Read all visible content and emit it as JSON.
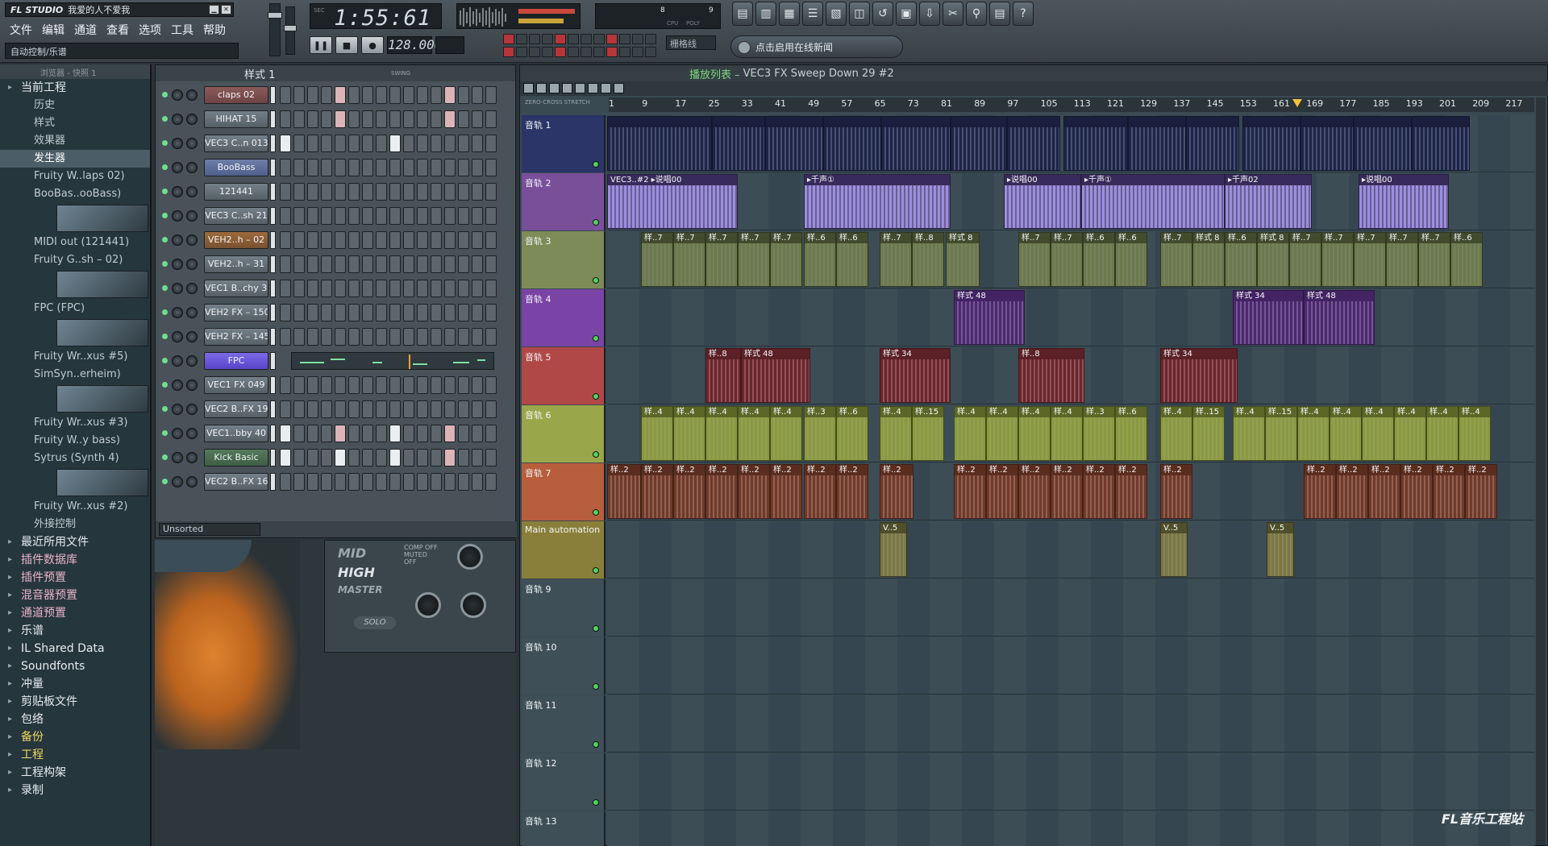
{
  "app": {
    "logo": "FL STUDIO",
    "song_title": "我爱的人不爱我",
    "win_min": "▁",
    "win_close": "✕",
    "hint": "自动控制/乐谱"
  },
  "menu": [
    "文件",
    "编辑",
    "通道",
    "查看",
    "选项",
    "工具",
    "帮助"
  ],
  "transport": {
    "time": "1:55:61",
    "time_units": "SEC",
    "tempo": "128.000",
    "tempo_label": "TEMPO",
    "pause": "❚❚",
    "stop": "■",
    "record": "●",
    "snap": "栅格线",
    "news": "点击启用在线新闻",
    "perf_left": "8",
    "perf_right": "9",
    "perf_cpu": "CPU",
    "perf_poly": "POLY"
  },
  "toolbar_icons": [
    "playlist-icon",
    "piano-roll-icon",
    "channel-rack-icon",
    "mixer-icon",
    "browser-icon",
    "plugin-icon",
    "undo-icon",
    "save-icon",
    "export-icon",
    "settings-icon",
    "search-icon",
    "clipboard-icon",
    "help-icon"
  ],
  "toolbar_glyphs": [
    "▤",
    "▥",
    "▦",
    "☰",
    "▧",
    "◫",
    "↺",
    "▣",
    "⇩",
    "✂",
    "⚲",
    "▤",
    "?"
  ],
  "browser": {
    "header": "浏览器 - 快照 1",
    "items": [
      {
        "label": "当前工程",
        "cls": "top"
      },
      {
        "label": "历史",
        "cls": "sub"
      },
      {
        "label": "样式",
        "cls": "sub"
      },
      {
        "label": "效果器",
        "cls": "sub"
      },
      {
        "label": "发生器",
        "cls": "sub sel"
      },
      {
        "label": "Fruity W..laps 02)",
        "cls": "sub"
      },
      {
        "label": "BooBas..ooBass)",
        "cls": "sub thumb"
      },
      {
        "label": "MIDI out (121441)",
        "cls": "sub"
      },
      {
        "label": "Fruity G..sh – 02)",
        "cls": "sub thumb"
      },
      {
        "label": "FPC (FPC)",
        "cls": "sub thumb"
      },
      {
        "label": "Fruity Wr..xus #5)",
        "cls": "sub"
      },
      {
        "label": "SimSyn..erheim)",
        "cls": "sub thumb"
      },
      {
        "label": "Fruity Wr..xus #3)",
        "cls": "sub"
      },
      {
        "label": "Fruity W..y bass)",
        "cls": "sub"
      },
      {
        "label": "Sytrus (Synth 4)",
        "cls": "sub thumb"
      },
      {
        "label": "Fruity Wr..xus #2)",
        "cls": "sub"
      },
      {
        "label": "外接控制",
        "cls": "sub"
      },
      {
        "label": "最近所用文件",
        "cls": "top"
      },
      {
        "label": "插件数据库",
        "cls": "top pink"
      },
      {
        "label": "插件预置",
        "cls": "top pink"
      },
      {
        "label": "混音器预置",
        "cls": "top pink"
      },
      {
        "label": "通道预置",
        "cls": "top pink"
      },
      {
        "label": "乐谱",
        "cls": "top"
      },
      {
        "label": "IL Shared Data",
        "cls": "top"
      },
      {
        "label": "Soundfonts",
        "cls": "top"
      },
      {
        "label": "冲量",
        "cls": "top"
      },
      {
        "label": "剪贴板文件",
        "cls": "top"
      },
      {
        "label": "包络",
        "cls": "top"
      },
      {
        "label": "备份",
        "cls": "top yellow"
      },
      {
        "label": "工程",
        "cls": "top yellow"
      },
      {
        "label": "工程构架",
        "cls": "top"
      },
      {
        "label": "录制",
        "cls": "top"
      }
    ]
  },
  "channel_rack": {
    "pattern": "样式 1",
    "swing": "SWING",
    "filter": "Unsorted",
    "channels": [
      {
        "name": "claps 02",
        "color": "red",
        "steps": [
          0,
          0,
          0,
          0,
          1,
          0,
          0,
          0,
          0,
          0,
          0,
          0,
          1,
          0,
          0,
          0
        ]
      },
      {
        "name": "HIHAT 15",
        "color": "",
        "steps": [
          0,
          0,
          0,
          0,
          1,
          0,
          0,
          0,
          0,
          0,
          0,
          0,
          1,
          0,
          0,
          0
        ]
      },
      {
        "name": "VEC3 C..n 013",
        "color": "",
        "steps": [
          2,
          0,
          0,
          0,
          0,
          0,
          0,
          0,
          2,
          0,
          0,
          0,
          0,
          0,
          0,
          0
        ]
      },
      {
        "name": "BooBass",
        "color": "blue",
        "steps": [
          0,
          0,
          0,
          0,
          0,
          0,
          0,
          0,
          0,
          0,
          0,
          0,
          0,
          0,
          0,
          0
        ]
      },
      {
        "name": "121441",
        "color": "",
        "steps": [
          0,
          0,
          0,
          0,
          0,
          0,
          0,
          0,
          0,
          0,
          0,
          0,
          0,
          0,
          0,
          0
        ]
      },
      {
        "name": "VEC3 C..sh 21",
        "color": "",
        "steps": [
          0,
          0,
          0,
          0,
          0,
          0,
          0,
          0,
          0,
          0,
          0,
          0,
          0,
          0,
          0,
          0
        ]
      },
      {
        "name": "VEH2..h – 02",
        "color": "orange",
        "steps": [
          0,
          0,
          0,
          0,
          0,
          0,
          0,
          0,
          0,
          0,
          0,
          0,
          0,
          0,
          0,
          0
        ]
      },
      {
        "name": "VEH2..h – 31",
        "color": "",
        "steps": [
          0,
          0,
          0,
          0,
          0,
          0,
          0,
          0,
          0,
          0,
          0,
          0,
          0,
          0,
          0,
          0
        ]
      },
      {
        "name": "VEC1 B..chy 33",
        "color": "",
        "steps": [
          0,
          0,
          0,
          0,
          0,
          0,
          0,
          0,
          0,
          0,
          0,
          0,
          0,
          0,
          0,
          0
        ]
      },
      {
        "name": "VEH2 FX – 150",
        "color": "",
        "steps": [
          0,
          0,
          0,
          0,
          0,
          0,
          0,
          0,
          0,
          0,
          0,
          0,
          0,
          0,
          0,
          0
        ]
      },
      {
        "name": "VEH2 FX – 145",
        "color": "",
        "steps": [
          0,
          0,
          0,
          0,
          0,
          0,
          0,
          0,
          0,
          0,
          0,
          0,
          0,
          0,
          0,
          0
        ]
      },
      {
        "name": "FPC",
        "color": "violet",
        "steps": "piano"
      },
      {
        "name": "VEC1 FX 049",
        "color": "",
        "steps": [
          0,
          0,
          0,
          0,
          0,
          0,
          0,
          0,
          0,
          0,
          0,
          0,
          0,
          0,
          0,
          0
        ]
      },
      {
        "name": "VEC2 B..FX 19",
        "color": "",
        "steps": [
          0,
          0,
          0,
          0,
          0,
          0,
          0,
          0,
          0,
          0,
          0,
          0,
          0,
          0,
          0,
          0
        ]
      },
      {
        "name": "VEC1..bby 40",
        "color": "",
        "steps": [
          2,
          0,
          0,
          0,
          1,
          0,
          0,
          0,
          2,
          0,
          0,
          0,
          1,
          0,
          0,
          0
        ]
      },
      {
        "name": "Kick Basic",
        "color": "green",
        "steps": [
          2,
          0,
          0,
          0,
          2,
          0,
          0,
          0,
          2,
          0,
          0,
          0,
          1,
          0,
          0,
          0
        ]
      },
      {
        "name": "VEC2 B..FX 16",
        "color": "",
        "steps": [
          0,
          0,
          0,
          0,
          0,
          0,
          0,
          0,
          0,
          0,
          0,
          0,
          0,
          0,
          0,
          0
        ]
      }
    ]
  },
  "mixer": {
    "labels": [
      "MID",
      "HIGH",
      "MASTER"
    ],
    "solo": "SOLO",
    "options": [
      "COMP OFF",
      "MUTED",
      "OFF"
    ]
  },
  "playlist": {
    "title_prefix": "播放列表 –",
    "title": "VEC3 FX Sweep Down 29 #2",
    "options": "ZERO-CROSS  STRETCH",
    "ruler": [
      "1",
      "9",
      "17",
      "25",
      "33",
      "41",
      "49",
      "57",
      "65",
      "73",
      "81",
      "89",
      "97",
      "105",
      "113",
      "121",
      "129",
      "137",
      "145",
      "153",
      "161",
      "169",
      "177",
      "185",
      "193",
      "201",
      "209",
      "217"
    ],
    "watermark": "FL音乐工程站",
    "tracks": [
      {
        "label": "音轨 1",
        "color": "#2b3567",
        "clipcolor": "#232a52",
        "bodycolor": "#1c2548",
        "clips": [
          [
            0,
            130,
            ""
          ],
          [
            130,
            66,
            ""
          ],
          [
            196,
            72,
            ""
          ],
          [
            268,
            72,
            ""
          ],
          [
            340,
            86,
            ""
          ],
          [
            426,
            70,
            ""
          ],
          [
            496,
            66,
            ""
          ],
          [
            566,
            80,
            ""
          ],
          [
            646,
            72,
            ""
          ],
          [
            718,
            66,
            ""
          ],
          [
            788,
            72,
            ""
          ],
          [
            860,
            66,
            ""
          ],
          [
            926,
            72,
            ""
          ],
          [
            998,
            72,
            ""
          ]
        ]
      },
      {
        "label": "音轨 2",
        "color": "#7a4f9a",
        "clipcolor": "#4b3a7a",
        "bodycolor": "#9a8fe0",
        "clips": [
          [
            0,
            162,
            "VEC3..#2 ▸说唱00"
          ],
          [
            244,
            182,
            "▸千声①"
          ],
          [
            492,
            96,
            "▸说唱00"
          ],
          [
            588,
            178,
            "▸千声①"
          ],
          [
            766,
            108,
            "▸千声02"
          ],
          [
            932,
            112,
            "▸说唱00"
          ]
        ]
      },
      {
        "label": "音轨 3",
        "color": "#7d8b58",
        "clipcolor": "#59643e",
        "bodycolor": "#6b7a4c",
        "clips": [
          [
            42,
            40,
            "样..7"
          ],
          [
            82,
            40,
            "样..7"
          ],
          [
            122,
            40,
            "样..7"
          ],
          [
            162,
            40,
            "样..7"
          ],
          [
            202,
            40,
            "样..7"
          ],
          [
            244,
            40,
            "样..6"
          ],
          [
            284,
            40,
            "样..6"
          ],
          [
            338,
            40,
            "样..7"
          ],
          [
            378,
            40,
            "样..8"
          ],
          [
            420,
            42,
            "样式 8"
          ],
          [
            510,
            40,
            "样..7"
          ],
          [
            550,
            40,
            "样..7"
          ],
          [
            590,
            40,
            "样..6"
          ],
          [
            630,
            40,
            "样..6"
          ],
          [
            686,
            40,
            "样..7"
          ],
          [
            726,
            40,
            "样式 8"
          ],
          [
            766,
            40,
            "样..6"
          ],
          [
            806,
            40,
            "样式 8"
          ],
          [
            846,
            40,
            "样..7"
          ],
          [
            886,
            40,
            "样..7"
          ],
          [
            926,
            40,
            "样..7"
          ],
          [
            966,
            40,
            "样..7"
          ],
          [
            1006,
            40,
            "样..7"
          ],
          [
            1046,
            40,
            "样..6"
          ]
        ]
      },
      {
        "label": "音轨 4",
        "color": "#7a44a6",
        "clipcolor": "#5a2f84",
        "bodycolor": "#4a2a6a",
        "clips": [
          [
            430,
            88,
            "样式 48"
          ],
          [
            776,
            88,
            "样式 34"
          ],
          [
            864,
            88,
            "样式 48"
          ]
        ]
      },
      {
        "label": "音轨 5",
        "color": "#b04848",
        "clipcolor": "#7a2c34",
        "bodycolor": "#6a262c",
        "clips": [
          [
            122,
            44,
            "样..8"
          ],
          [
            166,
            86,
            "样式 48"
          ],
          [
            338,
            88,
            "样式 34"
          ],
          [
            510,
            82,
            "样..8"
          ],
          [
            686,
            96,
            "样式 34"
          ]
        ]
      },
      {
        "label": "音轨 6",
        "color": "#9aa64a",
        "clipcolor": "#7b8a34",
        "bodycolor": "#8a9a3e",
        "clips": [
          [
            42,
            40,
            "样..4"
          ],
          [
            82,
            40,
            "样..4"
          ],
          [
            122,
            40,
            "样..4"
          ],
          [
            162,
            40,
            "样..4"
          ],
          [
            202,
            40,
            "样..4"
          ],
          [
            244,
            40,
            "样..3"
          ],
          [
            284,
            40,
            "样..6"
          ],
          [
            338,
            40,
            "样..4"
          ],
          [
            378,
            40,
            "样..15"
          ],
          [
            430,
            40,
            "样..4"
          ],
          [
            470,
            40,
            "样..4"
          ],
          [
            510,
            40,
            "样..4"
          ],
          [
            550,
            40,
            "样..4"
          ],
          [
            590,
            40,
            "样..3"
          ],
          [
            630,
            40,
            "样..6"
          ],
          [
            686,
            40,
            "样..4"
          ],
          [
            726,
            40,
            "样..15"
          ],
          [
            776,
            40,
            "样..4"
          ],
          [
            816,
            40,
            "样..15"
          ],
          [
            856,
            40,
            "样..4"
          ],
          [
            896,
            40,
            "样..4"
          ],
          [
            936,
            40,
            "样..4"
          ],
          [
            976,
            40,
            "样..4"
          ],
          [
            1016,
            40,
            "样..4"
          ],
          [
            1056,
            40,
            "样..4"
          ]
        ]
      },
      {
        "label": "音轨 7",
        "color": "#b85e3c",
        "clipcolor": "#7a3d2a",
        "bodycolor": "#6e3a2c",
        "clips": [
          [
            0,
            42,
            "样..2"
          ],
          [
            42,
            40,
            "样..2"
          ],
          [
            82,
            40,
            "样..2"
          ],
          [
            122,
            40,
            "样..2"
          ],
          [
            162,
            40,
            "样..2"
          ],
          [
            202,
            40,
            "样..2"
          ],
          [
            244,
            40,
            "样..2"
          ],
          [
            284,
            40,
            "样..2"
          ],
          [
            338,
            42,
            "样..2"
          ],
          [
            430,
            40,
            "样..2"
          ],
          [
            470,
            40,
            "样..2"
          ],
          [
            510,
            40,
            "样..2"
          ],
          [
            550,
            40,
            "样..2"
          ],
          [
            590,
            40,
            "样..2"
          ],
          [
            630,
            40,
            "样..2"
          ],
          [
            686,
            40,
            "样..2"
          ],
          [
            864,
            40,
            "样..2"
          ],
          [
            904,
            40,
            "样..2"
          ],
          [
            944,
            40,
            "样..2"
          ],
          [
            984,
            40,
            "样..2"
          ],
          [
            1024,
            40,
            "样..2"
          ],
          [
            1064,
            40,
            "样..2"
          ]
        ]
      },
      {
        "label": "Main automation",
        "color": "#8a7f3a",
        "clipcolor": "#6a6a3a",
        "bodycolor": "#7a7742",
        "clips": [
          [
            338,
            34,
            "V..5"
          ],
          [
            686,
            34,
            "V..5"
          ],
          [
            818,
            34,
            "V..5"
          ]
        ]
      },
      {
        "label": "音轨 9",
        "color": "#3f4f58",
        "clipcolor": "",
        "bodycolor": "",
        "clips": []
      },
      {
        "label": "音轨 10",
        "color": "#3f4f58",
        "clipcolor": "",
        "bodycolor": "",
        "clips": []
      },
      {
        "label": "音轨 11",
        "color": "#3f4f58",
        "clipcolor": "",
        "bodycolor": "",
        "clips": []
      },
      {
        "label": "音轨 12",
        "color": "#3f4f58",
        "clipcolor": "",
        "bodycolor": "",
        "clips": []
      },
      {
        "label": "音轨 13",
        "color": "#3f4f58",
        "clipcolor": "",
        "bodycolor": "",
        "clips": []
      }
    ]
  }
}
